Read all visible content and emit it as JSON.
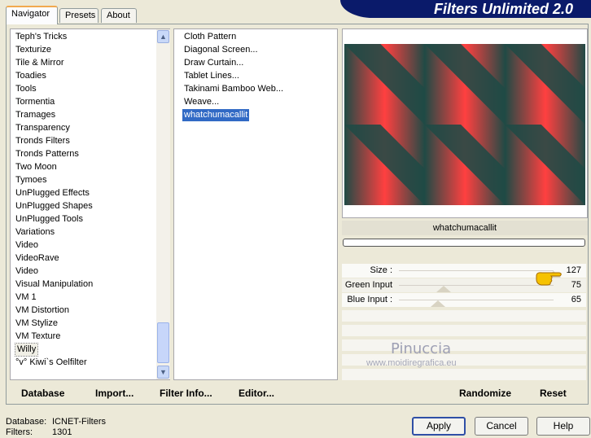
{
  "tabs": [
    "Navigator",
    "Presets",
    "About"
  ],
  "banner_title": "Filters Unlimited 2.0",
  "categories": [
    "Teph's Tricks",
    "Texturize",
    "Tile & Mirror",
    "Toadies",
    "Tools",
    "Tormentia",
    "Tramages",
    "Transparency",
    "Tronds Filters",
    "Tronds Patterns",
    "Two Moon",
    "Tymoes",
    "UnPlugged Effects",
    "UnPlugged Shapes",
    "UnPlugged Tools",
    "Variations",
    "Video",
    "VideoRave",
    "Video",
    "Visual Manipulation",
    "VM 1",
    "VM Distortion",
    "VM Stylize",
    "VM Texture",
    "Willy",
    "°v° Kiwi`s Oelfilter"
  ],
  "selected_category": "Willy",
  "filters": [
    "Cloth Pattern",
    "Diagonal Screen...",
    "Draw Curtain...",
    "Tablet Lines...",
    "Takinami Bamboo Web...",
    "Weave...",
    "whatchumacallit"
  ],
  "selected_filter": "whatchumacallit",
  "preview": {
    "filter_name": "whatchumacallit",
    "colors": {
      "red": "#ff4040",
      "dark": "#1f4a45"
    }
  },
  "params": [
    {
      "label": "Size :",
      "value": "127",
      "level": 1.0
    },
    {
      "label": "Green Input :",
      "value": "75",
      "level": 0.29
    },
    {
      "label": "Blue Input :",
      "value": "65",
      "level": 0.25
    }
  ],
  "watermark": {
    "name": "Pinuccia",
    "url": "www.moidiregrafica.eu"
  },
  "actions": {
    "database": "Database",
    "import": "Import...",
    "filter_info": "Filter Info...",
    "editor": "Editor...",
    "randomize": "Randomize",
    "reset": "Reset"
  },
  "status": {
    "database_label": "Database:",
    "database_value": "ICNET-Filters",
    "filters_label": "Filters:",
    "filters_value": "1301"
  },
  "buttons": {
    "apply": "Apply",
    "cancel": "Cancel",
    "help": "Help"
  }
}
